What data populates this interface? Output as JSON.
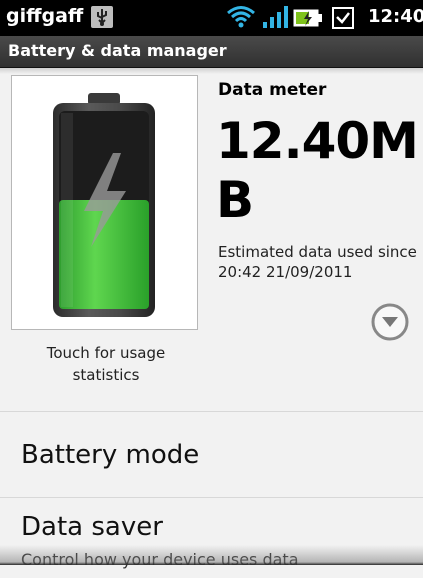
{
  "status_bar": {
    "carrier": "giffgaff",
    "time": "12:40",
    "icons": [
      "usb-icon",
      "wifi-icon",
      "signal-icon",
      "battery-charging-icon",
      "notification-check-icon"
    ]
  },
  "header": {
    "title": "Battery & data manager"
  },
  "battery": {
    "caption": "Touch for usage statistics",
    "charge_fraction": 0.55,
    "fill_color": "#3cc43c"
  },
  "data_meter": {
    "heading": "Data meter",
    "value": "12.40MB",
    "note": "Estimated data used since 20:42 21/09/2011"
  },
  "menu": {
    "battery_mode": {
      "label": "Battery mode"
    },
    "data_saver": {
      "label": "Data saver",
      "sub": "Control how your device uses data"
    }
  },
  "colors": {
    "accent_green": "#3cc43c",
    "status_blue": "#33b5e5"
  }
}
